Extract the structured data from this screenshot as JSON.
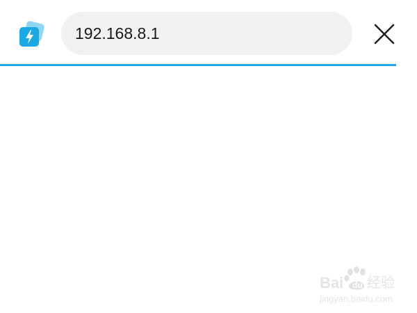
{
  "browser": {
    "url_value": "192.168.8.1",
    "app_icon": "lightning-bolt-cards-icon",
    "close_icon": "close-x-icon"
  },
  "progress": {
    "fraction": 1.0,
    "color": "#1aa9e3"
  },
  "colors": {
    "accent": "#1aa9e3",
    "url_bar_bg": "#f1f1f1",
    "page_bg": "#ffffff"
  },
  "watermark": {
    "logo_text": "Bai经验",
    "sub_text": "jingyan.baidu.com"
  }
}
